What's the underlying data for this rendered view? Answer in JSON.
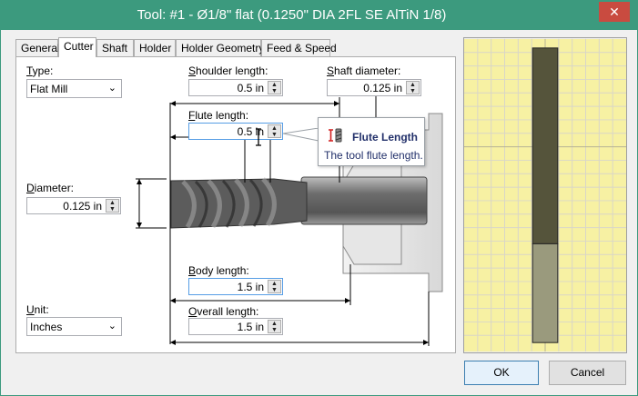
{
  "window": {
    "title": "Tool: #1 - Ø1/8\" flat (0.1250\" DIA 2FL SE AlTiN 1/8)",
    "close": "✕"
  },
  "tabs": [
    "General",
    "Cutter",
    "Shaft",
    "Holder",
    "Holder Geometry",
    "Feed & Speed"
  ],
  "active_tab": "Cutter",
  "fields": {
    "type": {
      "label_first": "T",
      "label_rest": "ype:",
      "value": "Flat Mill"
    },
    "diameter": {
      "label_first": "D",
      "label_rest": "iameter:",
      "value": "0.125 in"
    },
    "unit": {
      "label_first": "U",
      "label_rest": "nit:",
      "value": "Inches"
    },
    "shoulder_length": {
      "label_first": "S",
      "label_rest": "houlder length:",
      "value": "0.5 in"
    },
    "shaft_diameter": {
      "label_first": "S",
      "label_rest": "haft diameter:",
      "value": "0.125 in"
    },
    "flute_length": {
      "label_first": "F",
      "label_rest": "lute length:",
      "value": "0.5 in"
    },
    "body_length": {
      "label_first": "B",
      "label_rest": "ody length:",
      "value": "1.5 in"
    },
    "overall_length": {
      "label_first": "O",
      "label_rest": "verall length:",
      "value": "1.5 in"
    }
  },
  "tooltip": {
    "title": "Flute Length",
    "text": "The tool flute length."
  },
  "buttons": {
    "ok": "OK",
    "cancel": "Cancel"
  },
  "spin_up": "▲",
  "spin_down": "▼",
  "dropdown_arrow": "⌄",
  "colors": {
    "titlebar": "#3c9a7e",
    "preview_bg": "#f7f1a3",
    "tool_dark": "#5b5a3f"
  }
}
